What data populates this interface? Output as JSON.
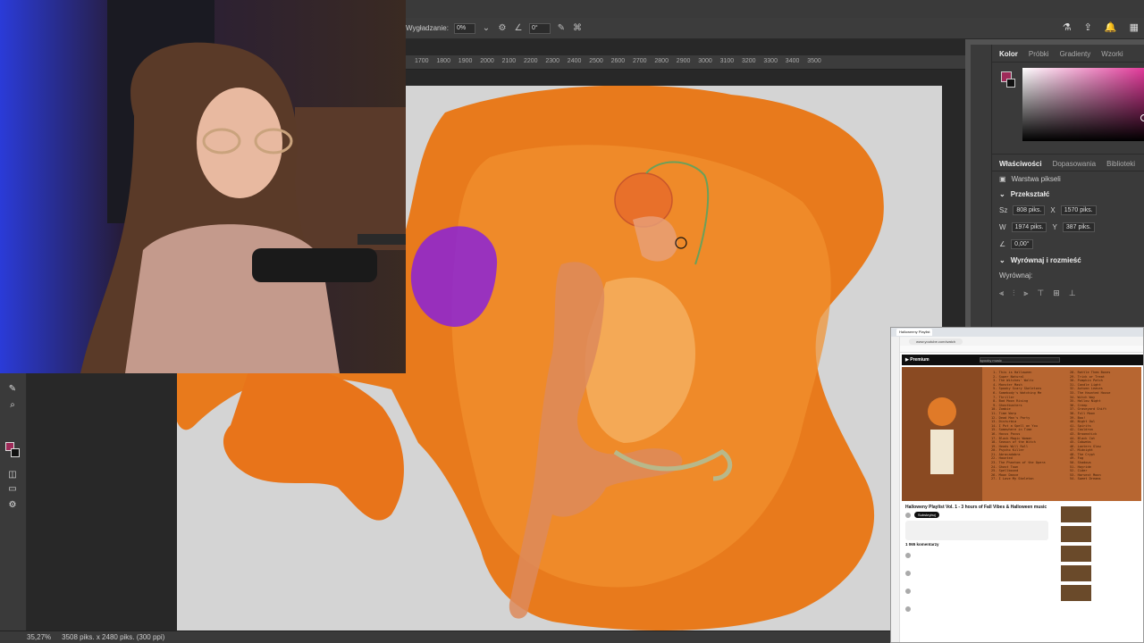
{
  "options_bar": {
    "smoothing_label": "Wygładzanie:",
    "smoothing_value": "0%",
    "angle_value": "0°"
  },
  "ruler": {
    "ticks": [
      "1700",
      "1800",
      "1900",
      "2000",
      "2100",
      "2200",
      "2300",
      "2400",
      "2500",
      "2600",
      "2700",
      "2800",
      "2900",
      "3000",
      "3100",
      "3200",
      "3300",
      "3400",
      "3500"
    ]
  },
  "color_panel": {
    "tabs": [
      "Kolor",
      "Próbki",
      "Gradienty",
      "Wzorki"
    ],
    "foreground_color": "#9e2b59",
    "background_color": "#111111"
  },
  "properties_panel": {
    "tabs": [
      "Właściwości",
      "Dopasowania",
      "Biblioteki"
    ],
    "layer_type": "Warstwa pikseli",
    "transform_heading": "Przekształć",
    "width_label": "Sz",
    "width_value": "808 piks.",
    "height_label": "W",
    "height_value": "1974 piks.",
    "x_label": "X",
    "x_value": "1570 piks.",
    "y_label": "Y",
    "y_value": "387 piks.",
    "angle_value": "0,00°",
    "align_heading": "Wyrównaj i rozmieść",
    "align_label": "Wyrównaj:"
  },
  "status_bar": {
    "zoom": "35,27%",
    "doc_info": "3508 piks. x 2480 piks. (300 ppi)"
  },
  "browser": {
    "url": "www.youtube.com/watch",
    "tab_title": "Halloweeny Playlist",
    "video_title": "Halloweny Playlist Vol. 1 - 3 hours of Fall Vibes & Halloween music",
    "subscribe": "Subskrybuj",
    "comments_count": "1 065 komentarzy",
    "search_placeholder": "spooky music",
    "tracks_col1": " 1. This is Halloween\n 2. Super Natural\n 3. The Witches' Waltz\n 4. Monster Mash\n 5. Spooky Scary Skeletons\n 6. Somebody's Watching Me\n 7. Thriller\n 8. Bad Moon Rising\n 9. Ghostbusters\n10. Zombie\n11. Time Warp\n12. Dead Man's Party\n13. Disturbia\n14. I Put a Spell on You\n15. Somewhere in Time\n16. Hocus Pocus\n17. Black Magic Woman\n18. Season of the Witch\n19. Heads Will Roll\n20. Psycho Killer\n21. Abracadabra\n22. Haunted\n23. The Phantom of the Opera\n24. Ghost Town\n25. Spellbound\n26. Moon Dance\n27. I Love My Skeleton",
    "tracks_col2": "28. Rattle Them Bones\n29. Trick or Treat\n30. Pumpkin Patch\n31. Candle Light\n32. Autumn Leaves\n33. The Haunted House\n34. Witch Way\n35. Hallow Night\n36. Creep\n37. Graveyard Shift\n38. Full Moon\n39. Boo!\n40. Night Owl\n41. Spirits\n42. Cauldron\n43. Broomstick\n44. Black Cat\n45. Cobwebs\n46. Lantern Glow\n47. Midnight\n48. The Crypt\n49. Fog\n50. Shadows\n51. Hayride\n52. Cider\n53. Harvest Moon\n54. Sweet Dreams"
  }
}
